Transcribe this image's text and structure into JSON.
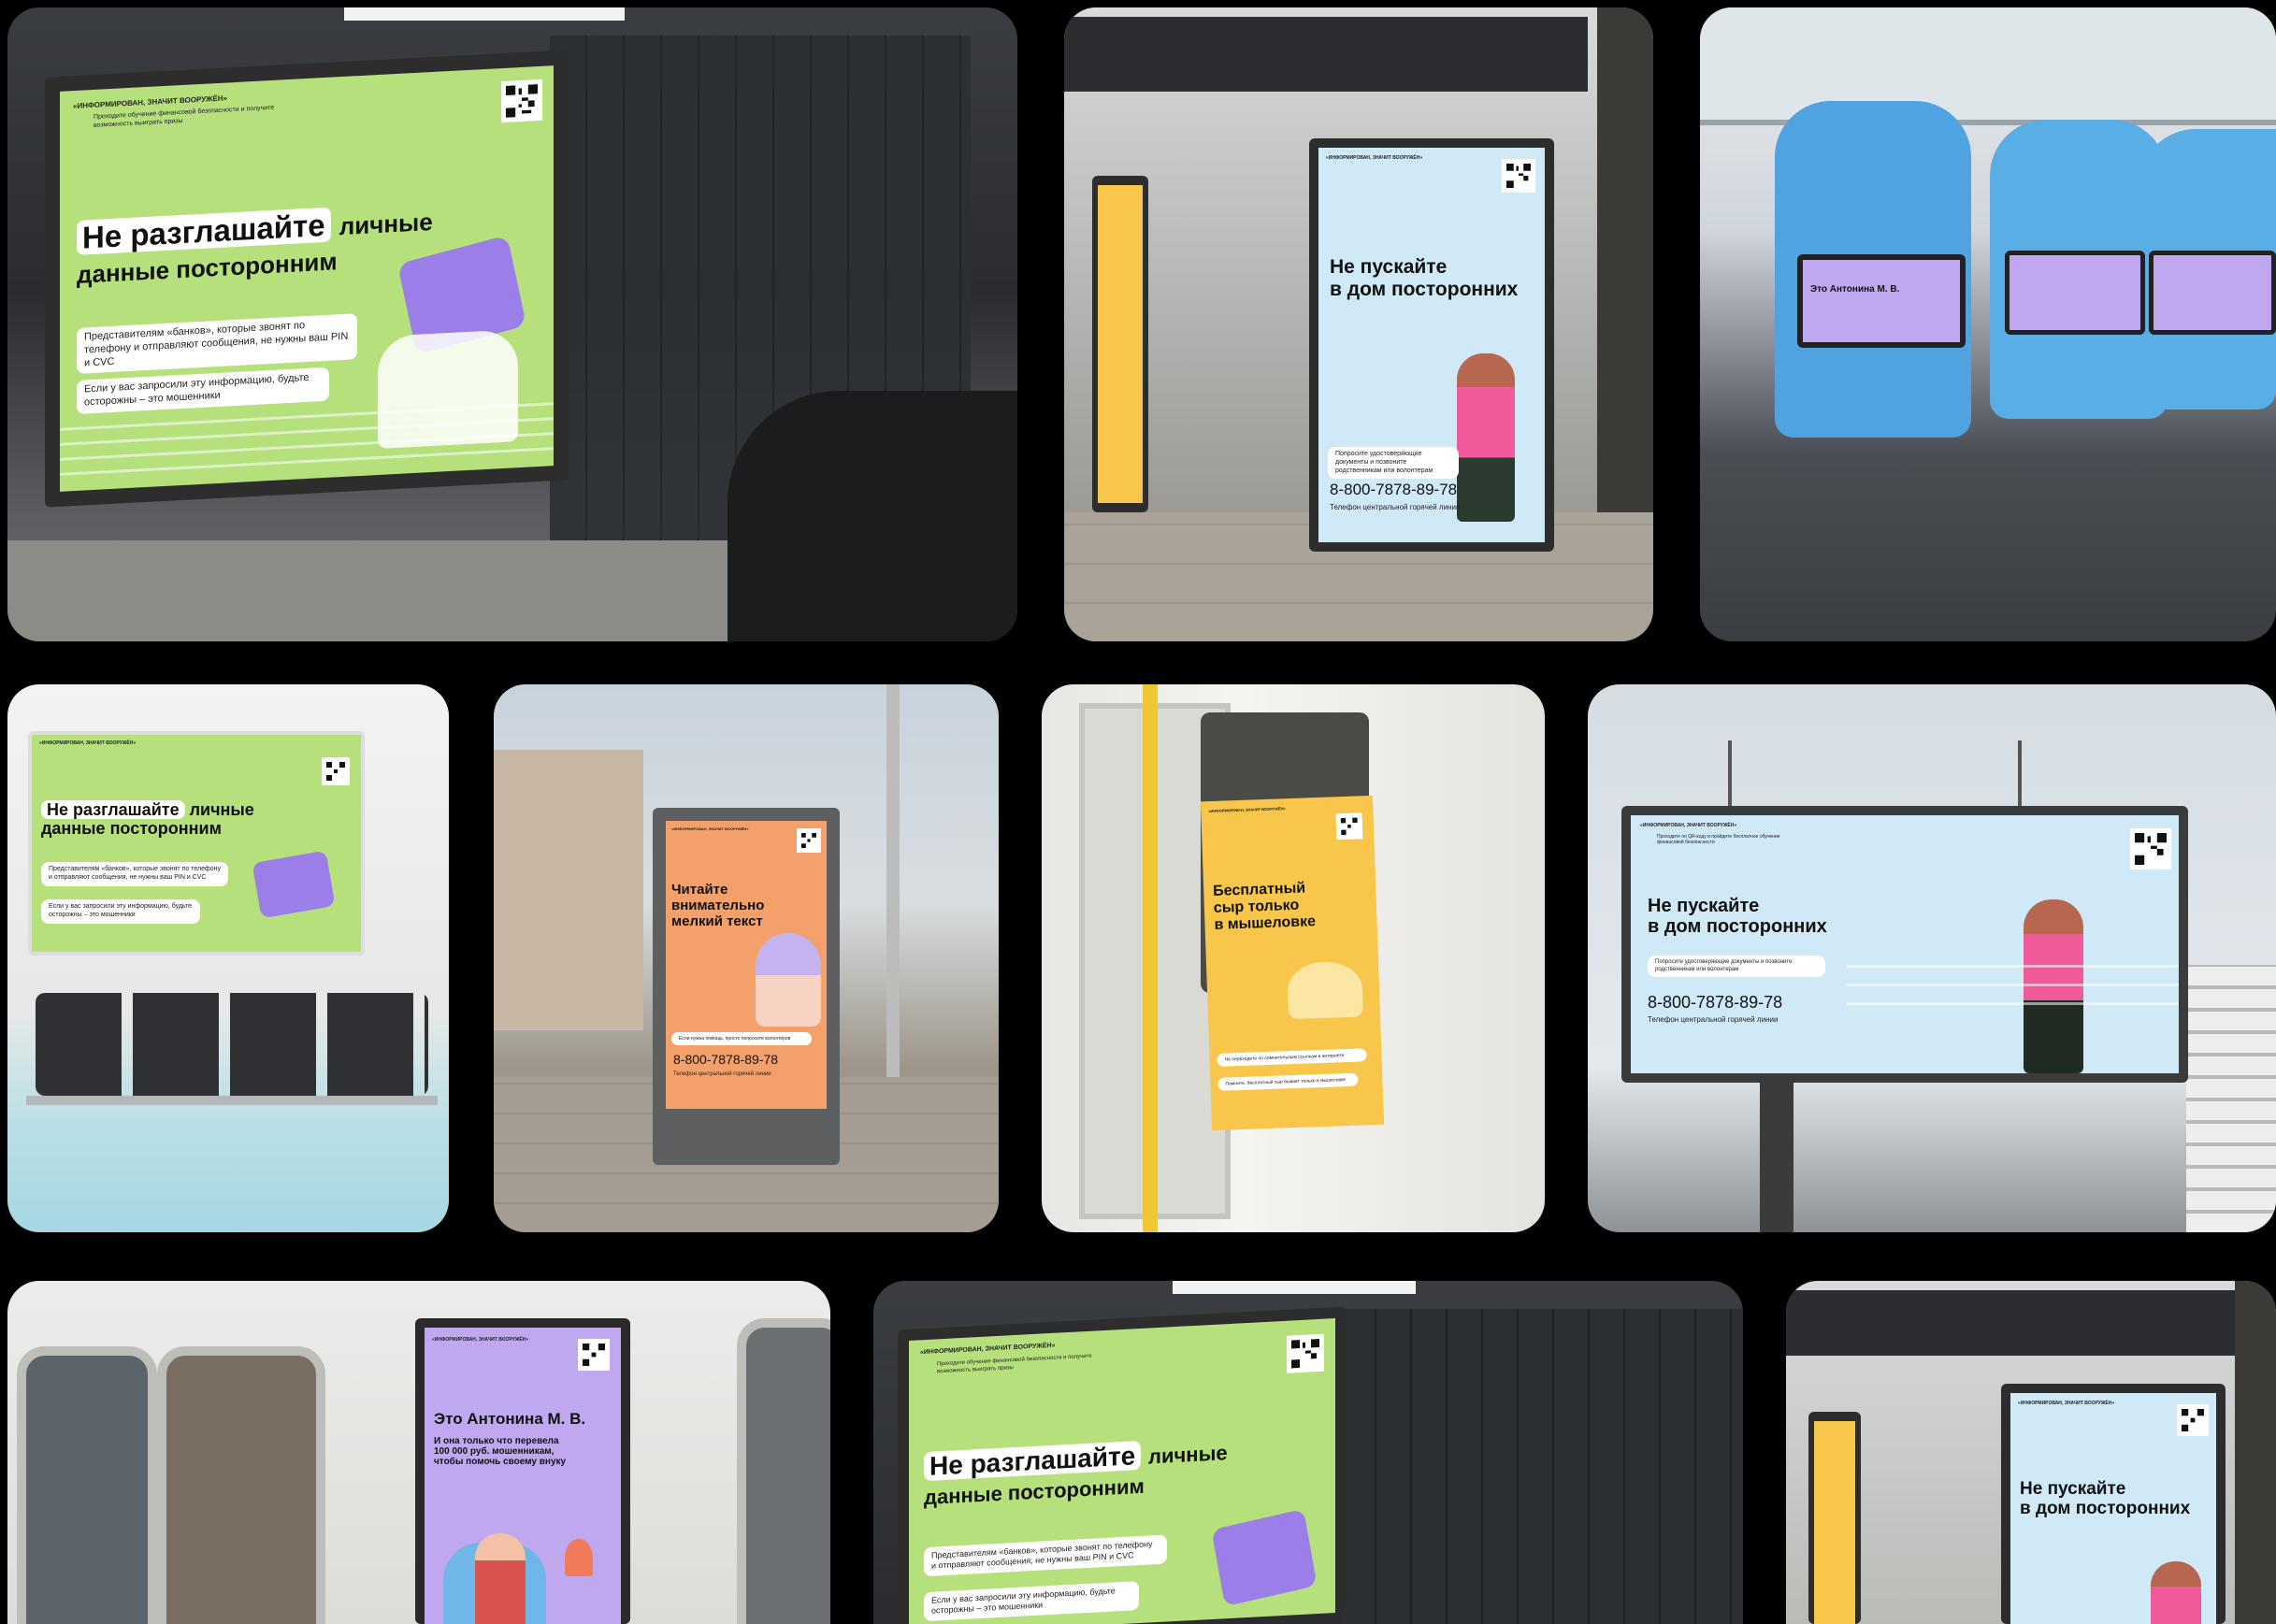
{
  "campaign": {
    "tagline": "«ИНФОРМИРОВАН, ЗНАЧИТ ВООРУЖЁН»",
    "info_line": "Проходите обучение финансовой безопасности и получите возможность выиграть призы",
    "info_line_billboard": "Проходите по QR-коду и пройдите бесплатное обучение финансовой безопасности",
    "hotline_number": "8-800-7878-89-78",
    "hotline_caption": "Телефон центральной горячей линии"
  },
  "posters": {
    "privacy": {
      "headline_highlight": "Не разглашайте",
      "headline_rest_1": "личные",
      "headline_line_2": "данные посторонним",
      "body_1": "Представителям «банков», которые звонят по телефону и отправляют сообщения, не нужны ваш PIN и CVC",
      "body_2": "Если у вас запросили эту информацию, будьте осторожны – это мошенники"
    },
    "stranger": {
      "headline_line_1": "Не пускайте",
      "headline_line_2": "в дом посторонних",
      "body": "Попросите удостоверяющие документы и позвоните родственникам или волонтерам"
    },
    "cheese": {
      "headline_line_1": "Бесплатный",
      "headline_line_2": "сыр только",
      "headline_line_3": "в мышеловке",
      "body_1": "Не переходите по сомнительным ссылкам в интернете",
      "body_2": "Помните, бесплатный сыр бывает только в мышеловке"
    },
    "finetext": {
      "headline_line_1": "Читайте",
      "headline_line_2": "внимательно",
      "headline_line_3": "мелкий текст",
      "body": "Если нужна помощь, просто попросите волонтеров"
    },
    "antonina": {
      "headline": "Это Антонина М. В.",
      "body_line_1": "И она только что перевела",
      "body_line_2": "100 000 руб. мошенникам,",
      "body_line_3": "чтобы помочь своему внуку"
    }
  },
  "colors": {
    "green": "#b5e07c",
    "blue": "#cfe9f7",
    "yellow": "#f7c64a",
    "orange": "#f3a06a",
    "purple": "#bfa8f0",
    "background": "#000000"
  }
}
